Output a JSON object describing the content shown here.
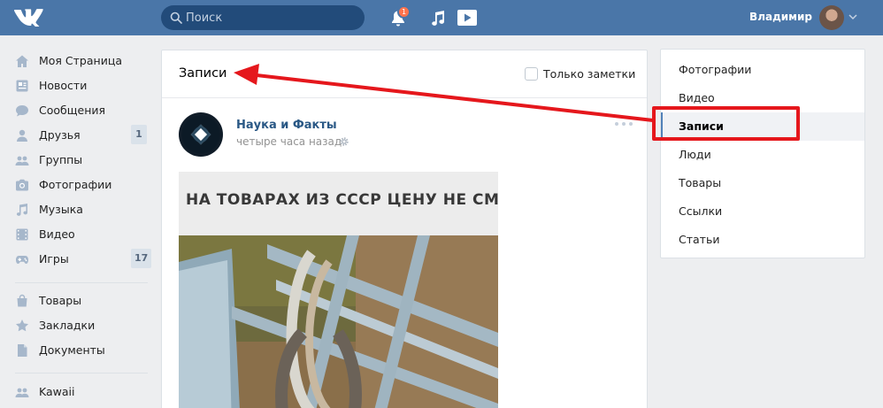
{
  "header": {
    "search_placeholder": "Поиск",
    "notifications_count": "1",
    "user_name": "Владимир",
    "colors": {
      "bar": "#4a76a8",
      "badge": "#ff734c"
    }
  },
  "left_menu": {
    "items": [
      {
        "label": "Моя Страница",
        "icon": "home-icon"
      },
      {
        "label": "Новости",
        "icon": "news-icon"
      },
      {
        "label": "Сообщения",
        "icon": "messages-icon"
      },
      {
        "label": "Друзья",
        "icon": "friends-icon",
        "count": "1"
      },
      {
        "label": "Группы",
        "icon": "groups-icon"
      },
      {
        "label": "Фотографии",
        "icon": "camera-icon"
      },
      {
        "label": "Музыка",
        "icon": "music-icon"
      },
      {
        "label": "Видео",
        "icon": "video-icon"
      },
      {
        "label": "Игры",
        "icon": "gamepad-icon",
        "count": "17"
      },
      {
        "label": "Товары",
        "icon": "bag-icon"
      },
      {
        "label": "Закладки",
        "icon": "star-icon"
      },
      {
        "label": "Документы",
        "icon": "document-icon"
      },
      {
        "label": "Kawaii",
        "icon": "community-icon"
      }
    ]
  },
  "wall": {
    "title": "Записи",
    "only_notes_label": "Только заметки",
    "post": {
      "author": "Наука и Факты",
      "time": "четыре часа назад",
      "image_caption": "НА ТОВАРАХ ИЗ СССР ЦЕНУ НЕ СМЕНИШЬ"
    }
  },
  "right_menu": {
    "items": [
      {
        "label": "Фотографии"
      },
      {
        "label": "Видео"
      },
      {
        "label": "Записи",
        "active": true
      },
      {
        "label": "Люди"
      },
      {
        "label": "Товары"
      },
      {
        "label": "Ссылки"
      },
      {
        "label": "Статьи"
      }
    ]
  },
  "annotation": {
    "color": "#e5171c"
  }
}
